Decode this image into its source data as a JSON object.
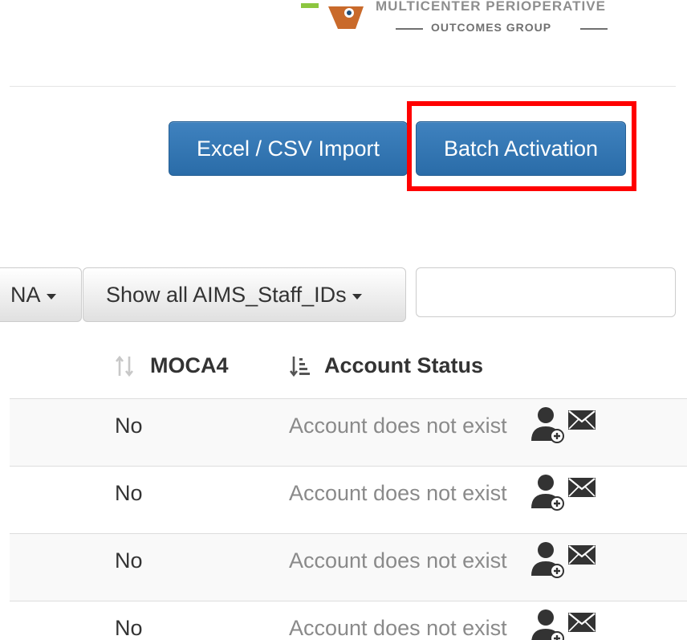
{
  "logo": {
    "line1": "MULTICENTER PERIOPERATIVE",
    "line2": "OUTCOMES GROUP",
    "colors": {
      "orange": "#c96a2b",
      "green": "#8cc63f",
      "gray": "#707070"
    }
  },
  "toolbar": {
    "import_label": "Excel / CSV Import",
    "batch_label": "Batch Activation",
    "button_color": "#3377b5",
    "highlight_color": "#ff0000"
  },
  "filters": {
    "na_label": "NA",
    "staff_label": "Show all AIMS_Staff_IDs",
    "search_value": ""
  },
  "table": {
    "columns": [
      {
        "label": "MOCA4",
        "sort_icon": "sort-icon"
      },
      {
        "label": "Account Status",
        "sort_icon": "sort-amount-desc-icon"
      }
    ],
    "rows": [
      {
        "moca4": "No",
        "status": "Account does not exist"
      },
      {
        "moca4": "No",
        "status": "Account does not exist"
      },
      {
        "moca4": "No",
        "status": "Account does not exist"
      },
      {
        "moca4": "No",
        "status": "Account does not exist"
      }
    ],
    "row_icons": [
      "add-user-icon",
      "envelope-icon"
    ]
  }
}
